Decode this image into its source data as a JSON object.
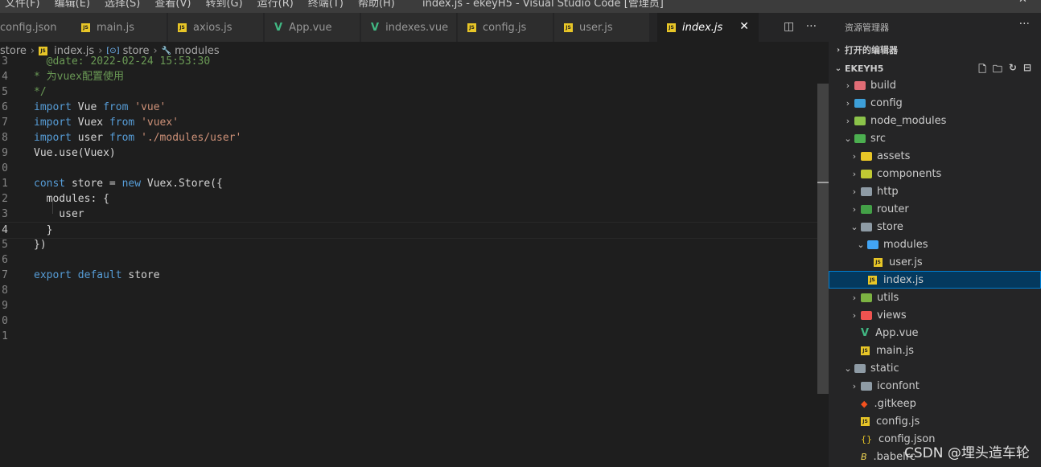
{
  "menu": [
    "文件(F)",
    "编辑(E)",
    "选择(S)",
    "查看(V)",
    "转到(G)",
    "运行(R)",
    "终端(T)",
    "帮助(H)"
  ],
  "window_title": "index.js - ekeyH5 - Visual Studio Code [管理员]",
  "tabs": [
    {
      "label": "config.json",
      "icon": "json"
    },
    {
      "label": "main.js",
      "icon": "js"
    },
    {
      "label": "axios.js",
      "icon": "js"
    },
    {
      "label": "App.vue",
      "icon": "vue"
    },
    {
      "label": "indexes.vue",
      "icon": "vue"
    },
    {
      "label": "config.js",
      "icon": "js"
    },
    {
      "label": "user.js",
      "icon": "js"
    },
    {
      "label": "index.js",
      "icon": "js",
      "active": true
    }
  ],
  "breadcrumb": {
    "part1": "store",
    "part2": "index.js",
    "part3": "store",
    "part4": "modules"
  },
  "editor": {
    "lines": [
      {
        "n": "3",
        "parts": [
          [
            "cm",
            "  @date: 2022-02-24 15:53:30"
          ]
        ]
      },
      {
        "n": "4",
        "parts": [
          [
            "cm",
            "* 为vuex配置使用"
          ]
        ]
      },
      {
        "n": "5",
        "parts": [
          [
            "cm",
            "*/"
          ]
        ]
      },
      {
        "n": "6",
        "parts": [
          [
            "kw",
            "import"
          ],
          [
            "id",
            " Vue "
          ],
          [
            "kw",
            "from"
          ],
          [
            "id",
            " "
          ],
          [
            "str",
            "'vue'"
          ]
        ]
      },
      {
        "n": "7",
        "parts": [
          [
            "kw",
            "import"
          ],
          [
            "id",
            " Vuex "
          ],
          [
            "kw",
            "from"
          ],
          [
            "id",
            " "
          ],
          [
            "str",
            "'vuex'"
          ]
        ]
      },
      {
        "n": "8",
        "parts": [
          [
            "kw",
            "import"
          ],
          [
            "id",
            " user "
          ],
          [
            "kw",
            "from"
          ],
          [
            "id",
            " "
          ],
          [
            "str",
            "'./modules/user'"
          ]
        ]
      },
      {
        "n": "9",
        "parts": [
          [
            "id",
            "Vue.use(Vuex)"
          ]
        ]
      },
      {
        "n": "0",
        "parts": []
      },
      {
        "n": "1",
        "parts": [
          [
            "kw",
            "const"
          ],
          [
            "id",
            " store = "
          ],
          [
            "kw",
            "new"
          ],
          [
            "id",
            " Vuex.Store({"
          ]
        ]
      },
      {
        "n": "2",
        "parts": [
          [
            "id",
            "  modules: {"
          ]
        ]
      },
      {
        "n": "3",
        "parts": [
          [
            "id",
            "    user"
          ]
        ]
      },
      {
        "n": "4",
        "parts": [
          [
            "id",
            "  }"
          ]
        ],
        "current": true
      },
      {
        "n": "5",
        "parts": [
          [
            "id",
            "})"
          ]
        ]
      },
      {
        "n": "6",
        "parts": []
      },
      {
        "n": "7",
        "parts": [
          [
            "kw",
            "export"
          ],
          [
            "id",
            " "
          ],
          [
            "kw",
            "default"
          ],
          [
            "id",
            " store"
          ]
        ]
      },
      {
        "n": "8",
        "parts": []
      },
      {
        "n": "9",
        "parts": []
      },
      {
        "n": "0",
        "parts": []
      },
      {
        "n": "1",
        "parts": []
      }
    ]
  },
  "sidebar": {
    "title": "资源管理器",
    "open_editors": "打开的编辑器",
    "project": "EKEYH5",
    "tree": [
      {
        "label": "build",
        "depth": 0,
        "arrow": "right",
        "type": "folder",
        "color": "#e06c75"
      },
      {
        "label": "config",
        "depth": 0,
        "arrow": "right",
        "type": "folder",
        "color": "#3d9fd8"
      },
      {
        "label": "node_modules",
        "depth": 0,
        "arrow": "right",
        "type": "folder",
        "color": "#8bc34a"
      },
      {
        "label": "src",
        "depth": 0,
        "arrow": "down",
        "type": "folder",
        "color": "#4caf50"
      },
      {
        "label": "assets",
        "depth": 1,
        "arrow": "right",
        "type": "folder",
        "color": "#e8c627"
      },
      {
        "label": "components",
        "depth": 1,
        "arrow": "right",
        "type": "folder",
        "color": "#c0ca33"
      },
      {
        "label": "http",
        "depth": 1,
        "arrow": "right",
        "type": "folder",
        "color": "#8e9ba5"
      },
      {
        "label": "router",
        "depth": 1,
        "arrow": "right",
        "type": "folder",
        "color": "#43a047"
      },
      {
        "label": "store",
        "depth": 1,
        "arrow": "down",
        "type": "folder",
        "color": "#8e9ba5"
      },
      {
        "label": "modules",
        "depth": 2,
        "arrow": "down",
        "type": "folder",
        "color": "#42a5f5"
      },
      {
        "label": "user.js",
        "depth": 3,
        "arrow": "",
        "type": "js",
        "color": "#e8c627"
      },
      {
        "label": "index.js",
        "depth": 2,
        "arrow": "",
        "type": "js",
        "color": "#e8c627",
        "selected": true
      },
      {
        "label": "utils",
        "depth": 1,
        "arrow": "right",
        "type": "folder",
        "color": "#7cb342"
      },
      {
        "label": "views",
        "depth": 1,
        "arrow": "right",
        "type": "folder",
        "color": "#ef5350"
      },
      {
        "label": "App.vue",
        "depth": 1,
        "arrow": "",
        "type": "vue",
        "color": "#41b883"
      },
      {
        "label": "main.js",
        "depth": 1,
        "arrow": "",
        "type": "js",
        "color": "#e8c627"
      },
      {
        "label": "static",
        "depth": 0,
        "arrow": "down",
        "type": "folder",
        "color": "#8e9ba5"
      },
      {
        "label": "iconfont",
        "depth": 1,
        "arrow": "right",
        "type": "folder",
        "color": "#8e9ba5"
      },
      {
        "label": ".gitkeep",
        "depth": 1,
        "arrow": "",
        "type": "git",
        "color": "#f4511e"
      },
      {
        "label": "config.js",
        "depth": 1,
        "arrow": "",
        "type": "js",
        "color": "#e8c627"
      },
      {
        "label": "config.json",
        "depth": 1,
        "arrow": "",
        "type": "json",
        "color": "#e8c627"
      },
      {
        "label": ".babelrc",
        "depth": 1,
        "arrow": "",
        "type": "babel",
        "color": "#f5da55"
      }
    ]
  },
  "watermark": "CSDN @埋头造车轮"
}
